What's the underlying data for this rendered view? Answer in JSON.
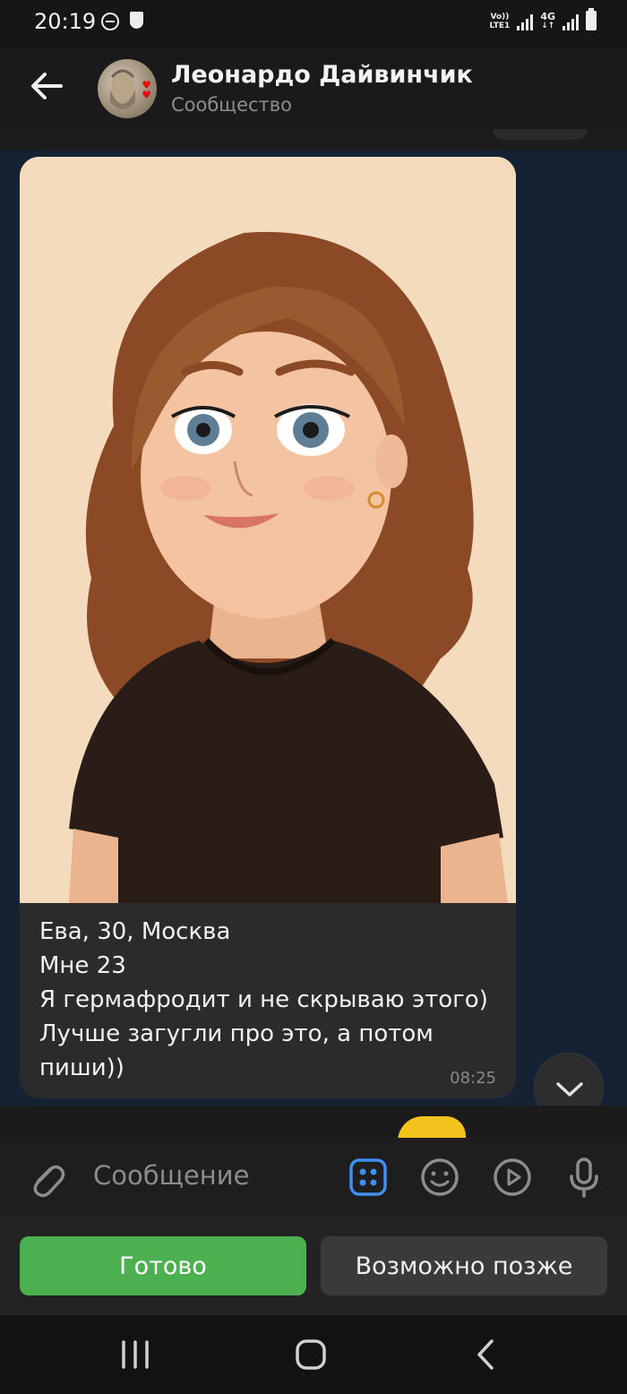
{
  "status_bar": {
    "time": "20:19",
    "volte_label": "Vo))",
    "lte_label": "LTE1",
    "network_label": "4G"
  },
  "header": {
    "title": "Леонардо Дайвинчик",
    "subtitle": "Сообщество"
  },
  "message": {
    "lines": [
      "Ева, 30, Москва",
      "Мне 23",
      "Я гермафродит и не скрываю этого)",
      "Лучше загугли про это, а потом",
      "пиши))"
    ],
    "time": "08:25"
  },
  "composer": {
    "placeholder": "Сообщение"
  },
  "reply_buttons": {
    "ready": "Готово",
    "later": "Возможно позже"
  },
  "colors": {
    "accent_blue": "#3f8ef0",
    "ready_green": "#4cb050",
    "chat_background": "#152233"
  }
}
